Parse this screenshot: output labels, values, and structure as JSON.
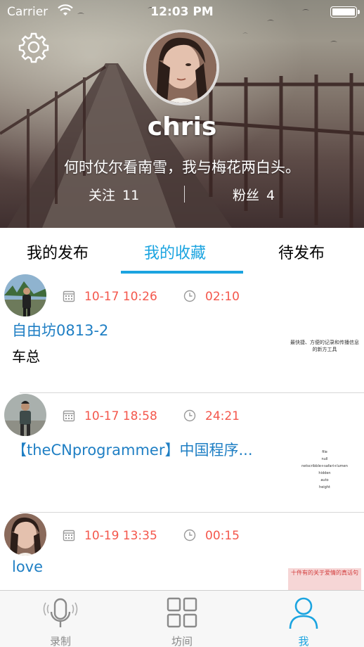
{
  "status_bar": {
    "carrier": "Carrier",
    "time": "12:03 PM"
  },
  "profile": {
    "name": "chris",
    "motto": "何时仗尔看南雪，我与梅花两白头。",
    "following_label": "关注",
    "following_count": "11",
    "followers_label": "粉丝",
    "followers_count": "4"
  },
  "tabs": [
    {
      "label": "我的发布",
      "active": false
    },
    {
      "label": "我的收藏",
      "active": true
    },
    {
      "label": "待发布",
      "active": false
    }
  ],
  "items": [
    {
      "date": "10-17 10:26",
      "duration": "02:10",
      "title": "自由坊0813-2",
      "subtitle": "车总",
      "thumb_text": "最快捷、方便的记录和传播信息的新方工具"
    },
    {
      "date": "10-17 18:58",
      "duration": "24:21",
      "title": "【theCNprogrammer】中国程序...",
      "subtitle": "",
      "thumb_text": "file\nnull\nnetscribble+safari+lumen\nhidden\nauto\nheight"
    },
    {
      "date": "10-19 13:35",
      "duration": "00:15",
      "title": "love",
      "subtitle": "",
      "thumb_text": "十件有的关于爱情的真话句"
    }
  ],
  "tabbar": [
    {
      "label": "录制",
      "icon": "microphone-icon",
      "active": false
    },
    {
      "label": "坊间",
      "icon": "grid-icon",
      "active": false
    },
    {
      "label": "我",
      "icon": "person-icon",
      "active": true
    }
  ],
  "colors": {
    "accent": "#1ba4e0",
    "time_red": "#f4574c",
    "title_blue": "#1f7fc4"
  }
}
